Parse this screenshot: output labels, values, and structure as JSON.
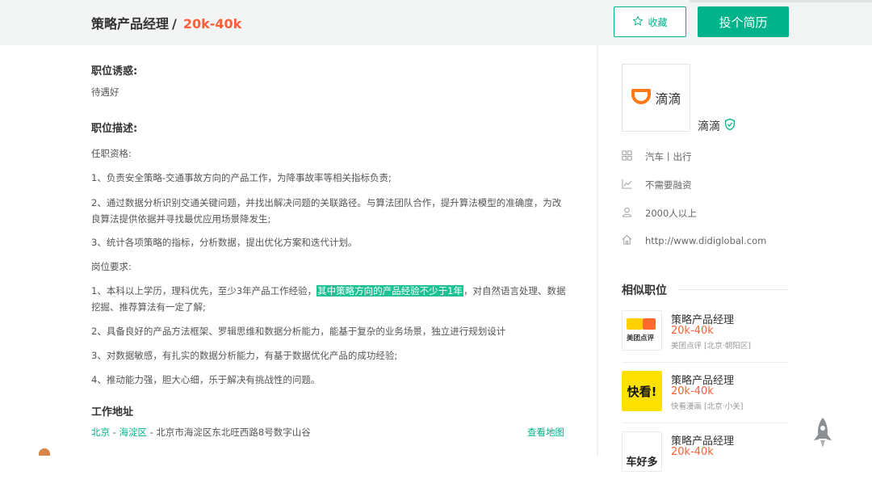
{
  "header": {
    "job_title": "策略产品经理",
    "separator": "/",
    "salary": "20k-40k",
    "fav_label": "收藏",
    "apply_label": "投个简历"
  },
  "job": {
    "perk_title": "职位诱惑:",
    "perk_text": "待遇好",
    "desc_title": "职位描述:",
    "qual_heading": "任职资格:",
    "qual_items": [
      "1、负责安全策略-交通事故方向的产品工作，为降事故率等相关指标负责;",
      "2、通过数据分析识别交通关键问题，并找出解决问题的关联路径。与算法团队合作，提升算法模型的准确度，为改良算法提供依据并寻找最优应用场景降发生;",
      "3、统计各项策略的指标，分析数据，提出优化方案和迭代计划。"
    ],
    "req_heading": "岗位要求:",
    "req_1_a": "1、本科以上学历，理科优先，至少3年产品工作经验，",
    "req_1_highlight": "其中策略方向的产品经验不少于1年",
    "req_1_b": "，对自然语言处理、数据挖掘、推荐算法有一定了解;",
    "req_items": [
      "2、具备良好的产品方法框架、罗辑思维和数据分析能力，能基于复杂的业务场景，独立进行规划设计",
      "3、对数据敏感，有扎实的数据分析能力，有基于数据优化产品的成功经验;",
      "4、推动能力强，胆大心细，乐于解决有挑战性的问题。"
    ],
    "addr_title": "工作地址",
    "addr_city": "北京",
    "addr_dash1": " - ",
    "addr_district": "海淀区",
    "addr_dash2": " - ",
    "addr_detail": "北京市海淀区东北旺西路8号数字山谷",
    "map_link": "查看地图"
  },
  "company": {
    "logo_text": "滴滴",
    "name": "滴滴",
    "industry": "汽车丨出行",
    "funding": "不需要融资",
    "size": "2000人以上",
    "website": "http://www.didiglobal.com"
  },
  "similar": {
    "title": "相似职位",
    "items": [
      {
        "title": "策略产品经理",
        "salary": "20k-40k",
        "company": "美团点评 [北京·朝阳区]",
        "logo_text": "美团点评"
      },
      {
        "title": "策略产品经理",
        "salary": "20k-40k",
        "company": "快看漫画 [北京·小关]",
        "logo_text": "快看!"
      },
      {
        "title": "策略产品经理",
        "salary": "20k-40k",
        "company": "",
        "logo_text": "车好多"
      }
    ]
  },
  "colors": {
    "accent": "#00b38a",
    "salary": "#fd5f39"
  }
}
